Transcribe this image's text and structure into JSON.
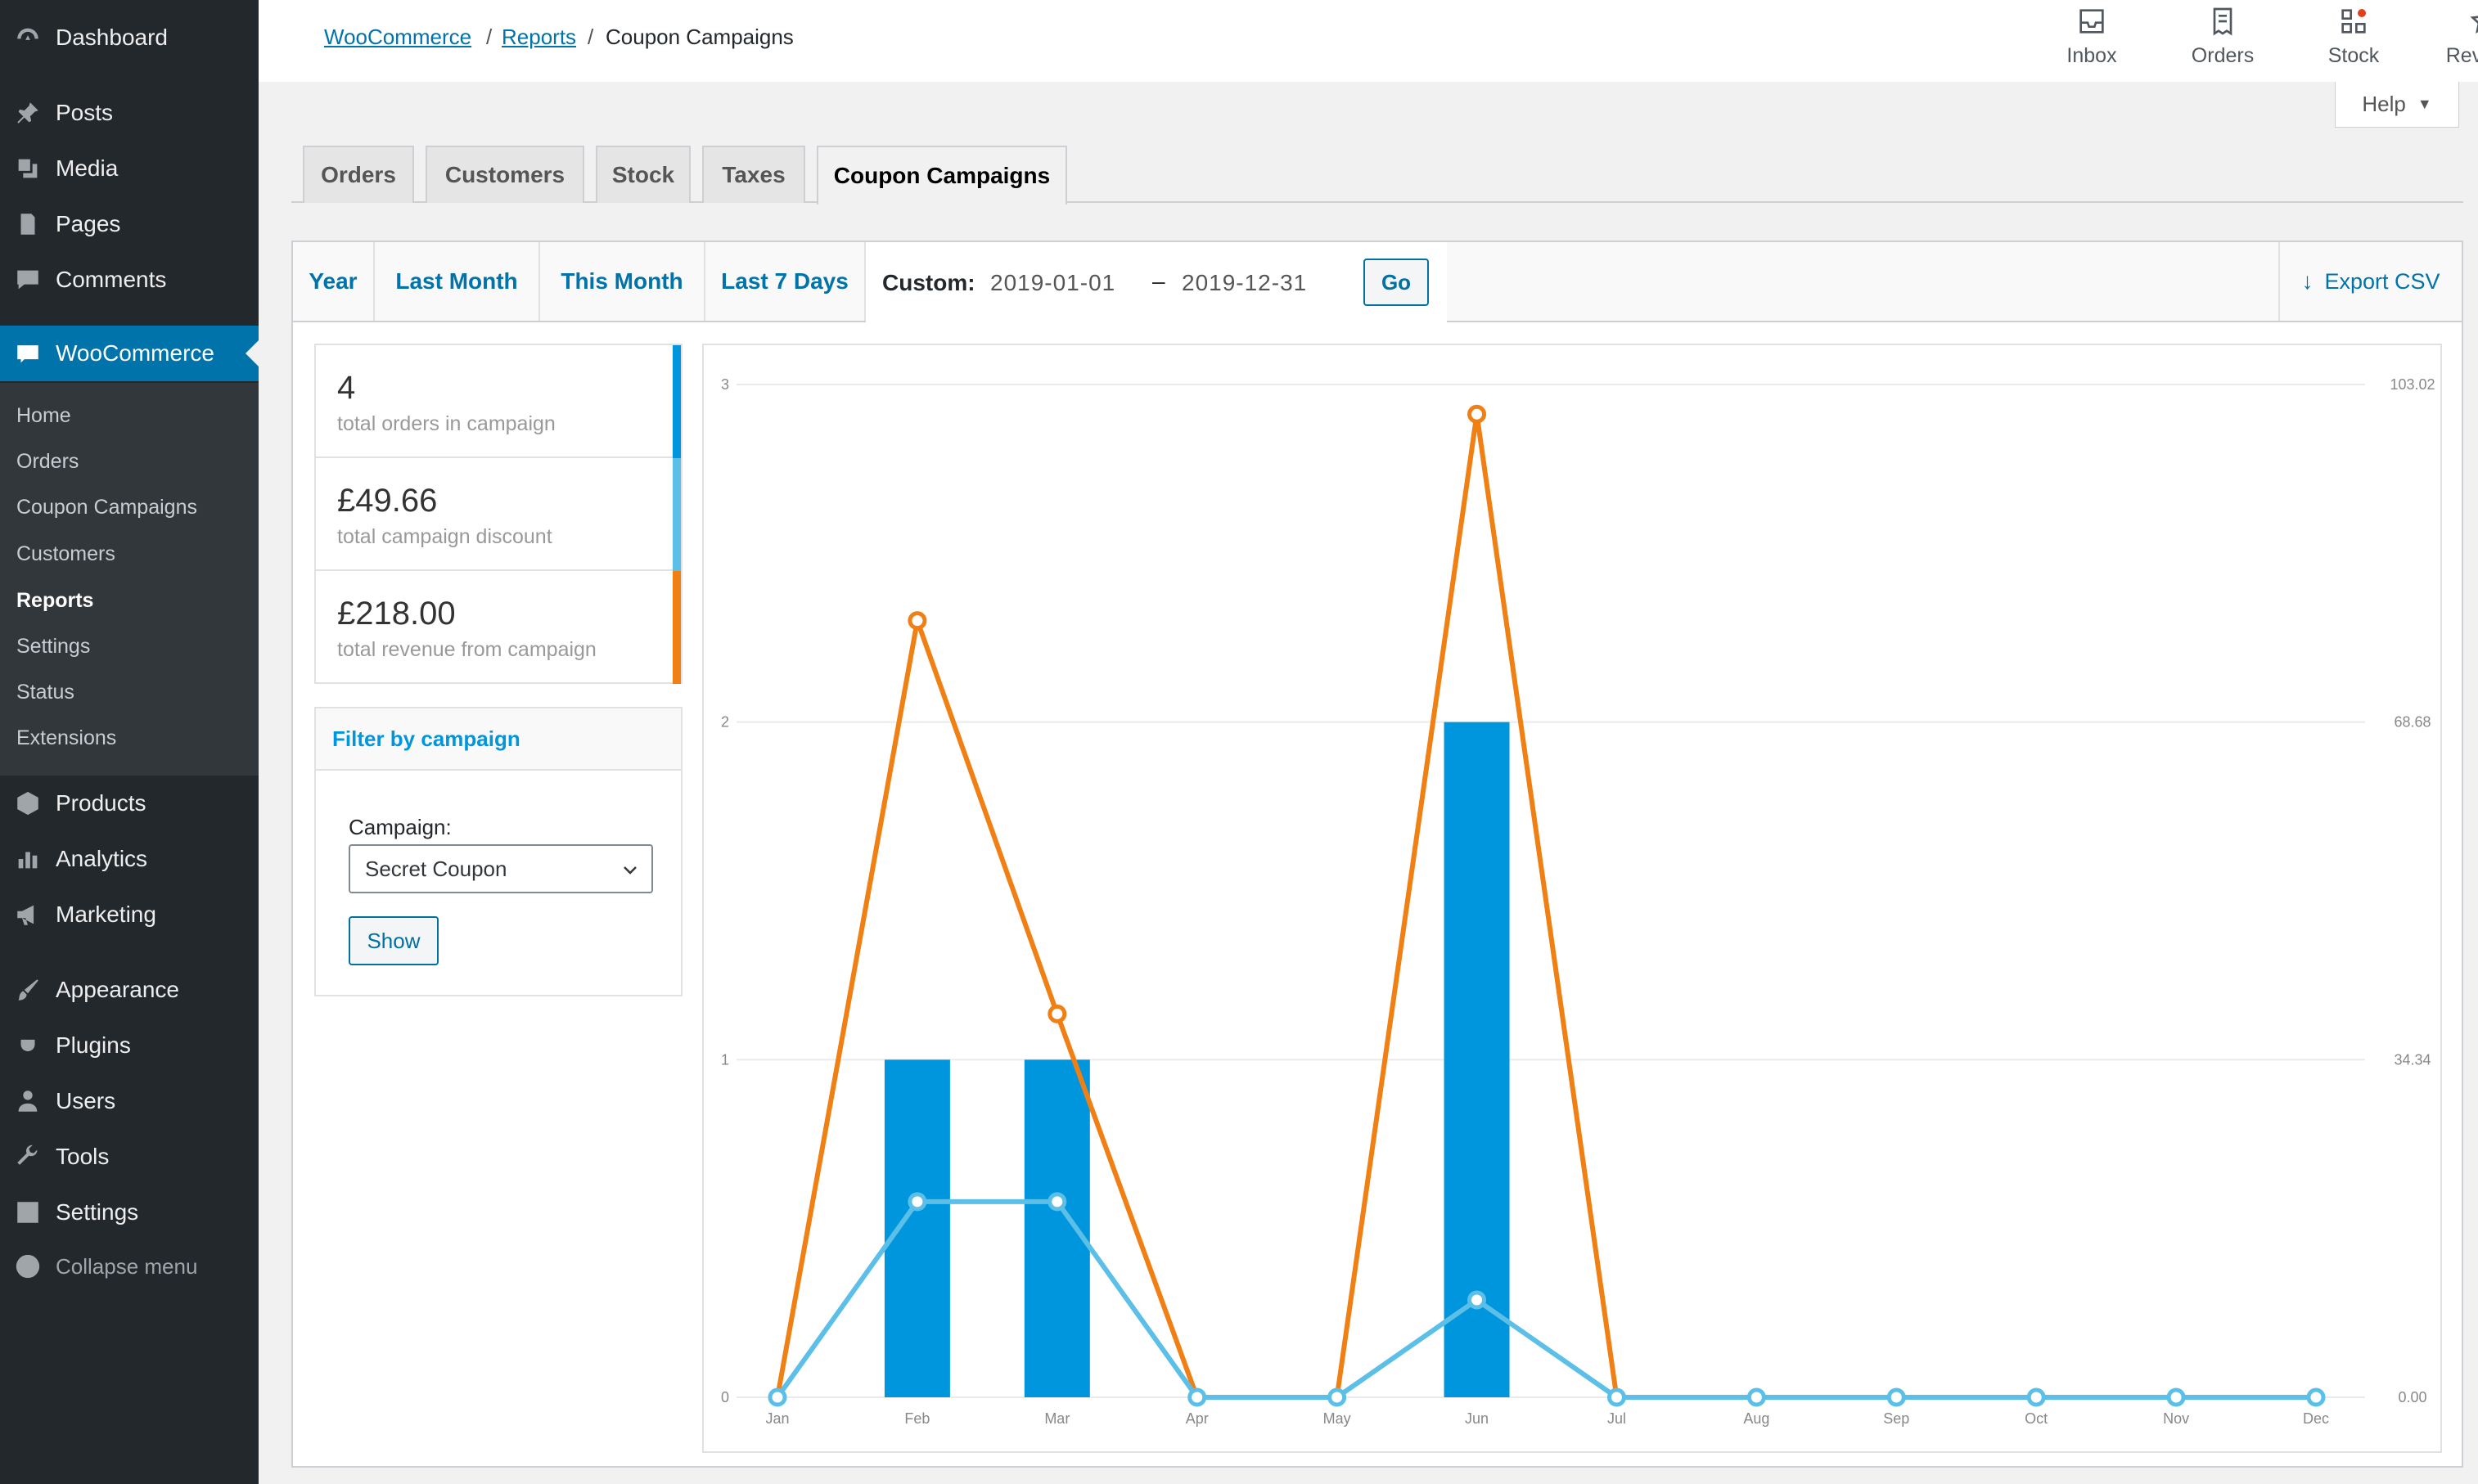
{
  "sidebar": {
    "items": [
      {
        "label": "Dashboard",
        "icon": "dashboard-icon"
      },
      {
        "label": "Posts",
        "icon": "pin-icon"
      },
      {
        "label": "Media",
        "icon": "media-icon"
      },
      {
        "label": "Pages",
        "icon": "pages-icon"
      },
      {
        "label": "Comments",
        "icon": "comments-icon"
      },
      {
        "label": "WooCommerce",
        "icon": "woo-icon"
      },
      {
        "label": "Products",
        "icon": "box-icon"
      },
      {
        "label": "Analytics",
        "icon": "bar-chart-icon"
      },
      {
        "label": "Marketing",
        "icon": "megaphone-icon"
      },
      {
        "label": "Appearance",
        "icon": "brush-icon"
      },
      {
        "label": "Plugins",
        "icon": "plug-icon"
      },
      {
        "label": "Users",
        "icon": "user-icon"
      },
      {
        "label": "Tools",
        "icon": "wrench-icon"
      },
      {
        "label": "Settings",
        "icon": "sliders-icon"
      },
      {
        "label": "Collapse menu",
        "icon": "collapse-icon"
      }
    ],
    "submenu": [
      "Home",
      "Orders",
      "Coupon Campaigns",
      "Customers",
      "Reports",
      "Settings",
      "Status",
      "Extensions"
    ]
  },
  "breadcrumb": {
    "woocommerce": "WooCommerce",
    "reports": "Reports",
    "current": "Coupon Campaigns",
    "sep": "/"
  },
  "activity": [
    {
      "label": "Inbox",
      "icon": "inbox-icon"
    },
    {
      "label": "Orders",
      "icon": "orders-icon"
    },
    {
      "label": "Stock",
      "icon": "stock-icon"
    },
    {
      "label": "Reviews",
      "icon": "star-icon"
    }
  ],
  "help": {
    "label": "Help"
  },
  "tabs": [
    "Orders",
    "Customers",
    "Stock",
    "Taxes",
    "Coupon Campaigns"
  ],
  "ranges": [
    "Year",
    "Last Month",
    "This Month",
    "Last 7 Days"
  ],
  "custom": {
    "label": "Custom:",
    "from": "2019-01-01",
    "dash": "–",
    "to": "2019-12-31",
    "go": "Go"
  },
  "export": {
    "label": "Export CSV"
  },
  "stats": [
    {
      "value": "4",
      "label": "total orders in campaign",
      "color": "#0096dd"
    },
    {
      "value": "£49.66",
      "label": "total campaign discount",
      "color": "#5bbfe8"
    },
    {
      "value": "£218.00",
      "label": "total revenue from campaign",
      "color": "#f07f14"
    }
  ],
  "filter": {
    "title": "Filter by campaign",
    "campaign_label": "Campaign:",
    "campaign_value": "Secret Coupon",
    "show": "Show"
  },
  "colors": {
    "accent": "#0073aa",
    "orders": "#0096dd",
    "discount": "#5bbfe8",
    "revenue": "#f07f14"
  },
  "chart_data": {
    "type": "bar",
    "categories": [
      "Jan",
      "Feb",
      "Mar",
      "Apr",
      "May",
      "Jun",
      "Jul",
      "Aug",
      "Sep",
      "Oct",
      "Nov",
      "Dec"
    ],
    "left_ticks": [
      "0",
      "1",
      "2",
      "3"
    ],
    "right_ticks": [
      "0.00",
      "34.34",
      "68.68",
      "103.02"
    ],
    "ylim_left": [
      0,
      3
    ],
    "ylim_right": [
      0,
      103.02
    ],
    "series": [
      {
        "name": "total orders in campaign",
        "type": "bar",
        "axis": "left",
        "values": [
          0,
          1,
          1,
          0,
          0,
          2,
          0,
          0,
          0,
          0,
          0,
          0
        ]
      },
      {
        "name": "total campaign discount",
        "type": "line",
        "axis": "right",
        "values": [
          0,
          19.9,
          19.9,
          0,
          0,
          9.9,
          0,
          0,
          0,
          0,
          0,
          0
        ]
      },
      {
        "name": "total revenue from campaign",
        "type": "line",
        "axis": "right",
        "values": [
          0,
          79.0,
          39.0,
          0,
          0,
          100.0,
          0,
          0,
          0,
          0,
          0,
          0
        ]
      }
    ],
    "grid": true
  }
}
